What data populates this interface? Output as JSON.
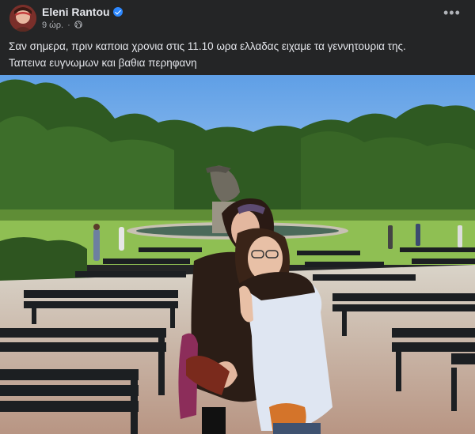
{
  "post": {
    "author": "Eleni Rantou",
    "timestamp": "9 ώρ.",
    "separator": "·",
    "privacy_icon": "globe-icon",
    "verified_icon": "verified-badge-icon",
    "more_icon": "more-options-icon",
    "caption_lines": [
      "Σαν σημερα, πριν καποια  χρονια στις 11.10 ωρα ελλαδας ειχαμε τα γεννητουρια της.",
      "Ταπεινα ευγνωμων και βαθια περηφανη"
    ],
    "photo_subject": "Two people posing in a park in front of a statue and rows of benches"
  },
  "colors": {
    "background": "#242526",
    "text_primary": "#e4e6eb",
    "text_secondary": "#b0b3b8",
    "verified_blue": "#2d88ff"
  }
}
